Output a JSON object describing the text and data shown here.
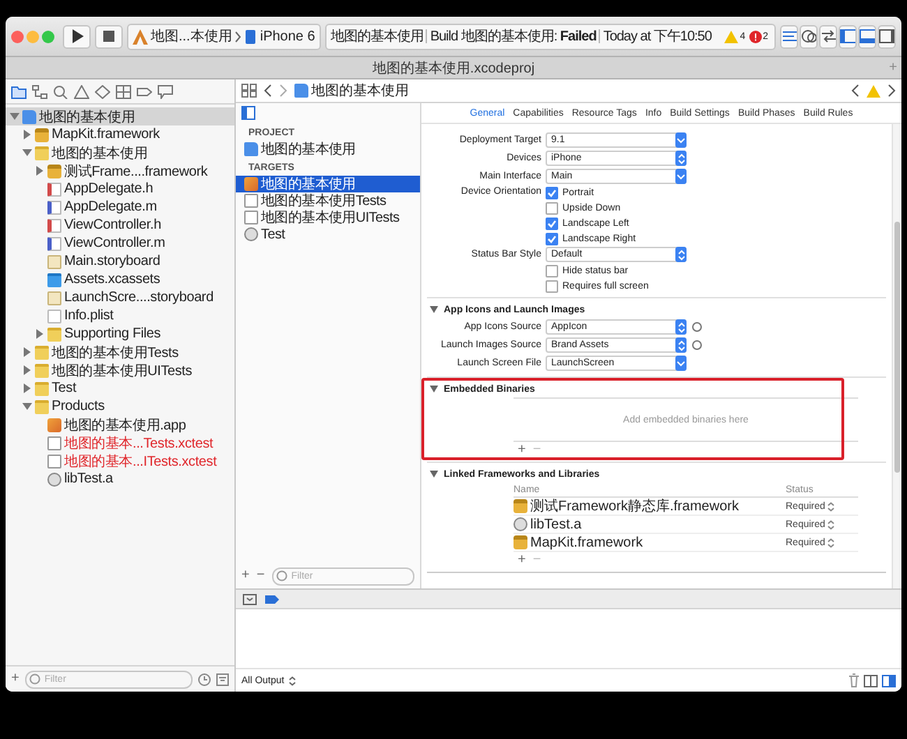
{
  "window": {
    "title": "地图的基本使用.xcodeproj",
    "new_tab": "+"
  },
  "toolbar": {
    "scheme": "地图...本使用",
    "device": "iPhone 6",
    "status_project": "地图的基本使用",
    "status_message": "Build 地图的基本使用: **Failed**",
    "status_time": "Today at 下午10:50",
    "warnings": "4",
    "errors": "2"
  },
  "navigator": {
    "items": [
      {
        "label": "地图的基本使用",
        "kind": "project",
        "selected": true,
        "missing": false,
        "expanded": true,
        "children": [
          {
            "label": "MapKit.framework",
            "kind": "framework",
            "selected": false,
            "missing": false,
            "expanded": false
          },
          {
            "label": "地图的基本使用",
            "kind": "folder",
            "selected": false,
            "missing": false,
            "expanded": true,
            "children": [
              {
                "label": "测试Frame....framework",
                "kind": "framework",
                "selected": false,
                "missing": false,
                "expanded": false
              },
              {
                "label": "AppDelegate.h",
                "kind": "h",
                "selected": false,
                "missing": false
              },
              {
                "label": "AppDelegate.m",
                "kind": "m",
                "selected": false,
                "missing": false
              },
              {
                "label": "ViewController.h",
                "kind": "h",
                "selected": false,
                "missing": false
              },
              {
                "label": "ViewController.m",
                "kind": "m",
                "selected": false,
                "missing": false
              },
              {
                "label": "Main.storyboard",
                "kind": "storyboard",
                "selected": false,
                "missing": false
              },
              {
                "label": "Assets.xcassets",
                "kind": "assets",
                "selected": false,
                "missing": false
              },
              {
                "label": "LaunchScre....storyboard",
                "kind": "storyboard",
                "selected": false,
                "missing": false
              },
              {
                "label": "Info.plist",
                "kind": "plist",
                "selected": false,
                "missing": false
              },
              {
                "label": "Supporting Files",
                "kind": "folder",
                "selected": false,
                "missing": false,
                "expanded": false
              }
            ]
          },
          {
            "label": "地图的基本使用Tests",
            "kind": "folder",
            "selected": false,
            "missing": false,
            "expanded": false
          },
          {
            "label": "地图的基本使用UITests",
            "kind": "folder",
            "selected": false,
            "missing": false,
            "expanded": false
          },
          {
            "label": "Test",
            "kind": "folder",
            "selected": false,
            "missing": false,
            "expanded": false
          },
          {
            "label": "Products",
            "kind": "folder",
            "selected": false,
            "missing": false,
            "expanded": true,
            "children": [
              {
                "label": "地图的基本使用.app",
                "kind": "app",
                "selected": false,
                "missing": false
              },
              {
                "label": "地图的基本...Tests.xctest",
                "kind": "xctest",
                "selected": false,
                "missing": true
              },
              {
                "label": "地图的基本...ITests.xctest",
                "kind": "xctest",
                "selected": false,
                "missing": true
              },
              {
                "label": "libTest.a",
                "kind": "lib",
                "selected": false,
                "missing": false
              }
            ]
          }
        ]
      }
    ],
    "filter_placeholder": "Filter",
    "add": "+"
  },
  "jump_bar": {
    "path": "地图的基本使用"
  },
  "targets_panel": {
    "sections": [
      {
        "header": "PROJECT",
        "items": [
          {
            "label": "地图的基本使用",
            "kind": "project",
            "selected": false
          }
        ]
      },
      {
        "header": "TARGETS",
        "items": [
          {
            "label": "地图的基本使用",
            "kind": "app",
            "selected": true
          },
          {
            "label": "地图的基本使用Tests",
            "kind": "xctest",
            "selected": false
          },
          {
            "label": "地图的基本使用UITests",
            "kind": "xctest",
            "selected": false
          },
          {
            "label": "Test",
            "kind": "lib",
            "selected": false
          }
        ]
      }
    ],
    "add": "+",
    "remove": "−",
    "filter_placeholder": "Filter"
  },
  "tabs": [
    {
      "label": "General",
      "selected": true
    },
    {
      "label": "Capabilities",
      "selected": false
    },
    {
      "label": "Resource Tags",
      "selected": false
    },
    {
      "label": "Info",
      "selected": false
    },
    {
      "label": "Build Settings",
      "selected": false
    },
    {
      "label": "Build Phases",
      "selected": false
    },
    {
      "label": "Build Rules",
      "selected": false
    }
  ],
  "deployment_info": {
    "fields": [
      {
        "label": "Deployment Target",
        "value": "9.1",
        "kind": "combo"
      },
      {
        "label": "Devices",
        "value": "iPhone",
        "kind": "popup"
      },
      {
        "label": "Main Interface",
        "value": "Main",
        "kind": "combo"
      }
    ],
    "orientation_label": "Device Orientation",
    "orientations": [
      {
        "label": "Portrait",
        "checked": true
      },
      {
        "label": "Upside Down",
        "checked": false
      },
      {
        "label": "Landscape Left",
        "checked": true
      },
      {
        "label": "Landscape Right",
        "checked": true
      }
    ],
    "status_bar": {
      "label": "Status Bar Style",
      "value": "Default",
      "kind": "popup"
    },
    "options": [
      {
        "label": "Hide status bar",
        "checked": false
      },
      {
        "label": "Requires full screen",
        "checked": false
      }
    ]
  },
  "app_icons": {
    "title": "App Icons and Launch Images",
    "expanded": true,
    "fields": [
      {
        "label": "App Icons Source",
        "value": "AppIcon",
        "kind": "popup",
        "info": true
      },
      {
        "label": "Launch Images Source",
        "value": "Brand Assets",
        "kind": "popup",
        "info": true
      },
      {
        "label": "Launch Screen File",
        "value": "LaunchScreen",
        "kind": "combo",
        "info": false
      }
    ]
  },
  "embedded_binaries": {
    "title": "Embedded Binaries",
    "expanded": true,
    "empty_text": "Add embedded binaries here",
    "add": "+",
    "remove": "−"
  },
  "linked_frameworks": {
    "title": "Linked Frameworks and Libraries",
    "expanded": true,
    "columns": [
      "Name",
      "Status"
    ],
    "rows": [
      {
        "name": "测试Framework静态库.framework",
        "kind": "framework",
        "status": "Required"
      },
      {
        "name": "libTest.a",
        "kind": "lib",
        "status": "Required"
      },
      {
        "name": "MapKit.framework",
        "kind": "framework",
        "status": "Required"
      }
    ],
    "add": "+",
    "remove": "−"
  },
  "debug": {
    "output_selector": "All Output"
  }
}
